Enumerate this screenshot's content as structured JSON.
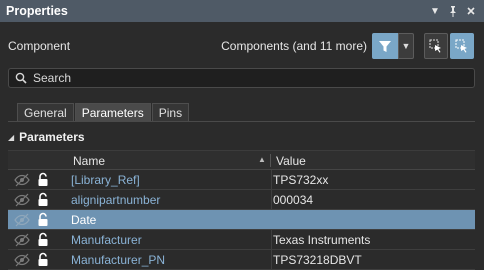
{
  "panel": {
    "title": "Properties"
  },
  "component": {
    "label": "Component",
    "scope": "Components (and 11 more)"
  },
  "search": {
    "placeholder": "Search"
  },
  "tabs": [
    {
      "label": "General"
    },
    {
      "label": "Parameters"
    },
    {
      "label": "Pins"
    }
  ],
  "section": {
    "title": "Parameters"
  },
  "grid": {
    "headers": {
      "name": "Name",
      "value": "Value"
    },
    "rows": [
      {
        "name": "[Library_Ref]",
        "value": "TPS732xx"
      },
      {
        "name": "alignipartnumber",
        "value": "000034"
      },
      {
        "name": "Date",
        "value": ""
      },
      {
        "name": "Manufacturer",
        "value": "Texas Instruments"
      },
      {
        "name": "Manufacturer_PN",
        "value": "TPS73218DBVT"
      }
    ]
  },
  "colors": {
    "titlebar": "#4f5a66",
    "accent": "#7aa7c7",
    "selected_row": "#6e93b2",
    "link_text": "#8ab3d6"
  }
}
